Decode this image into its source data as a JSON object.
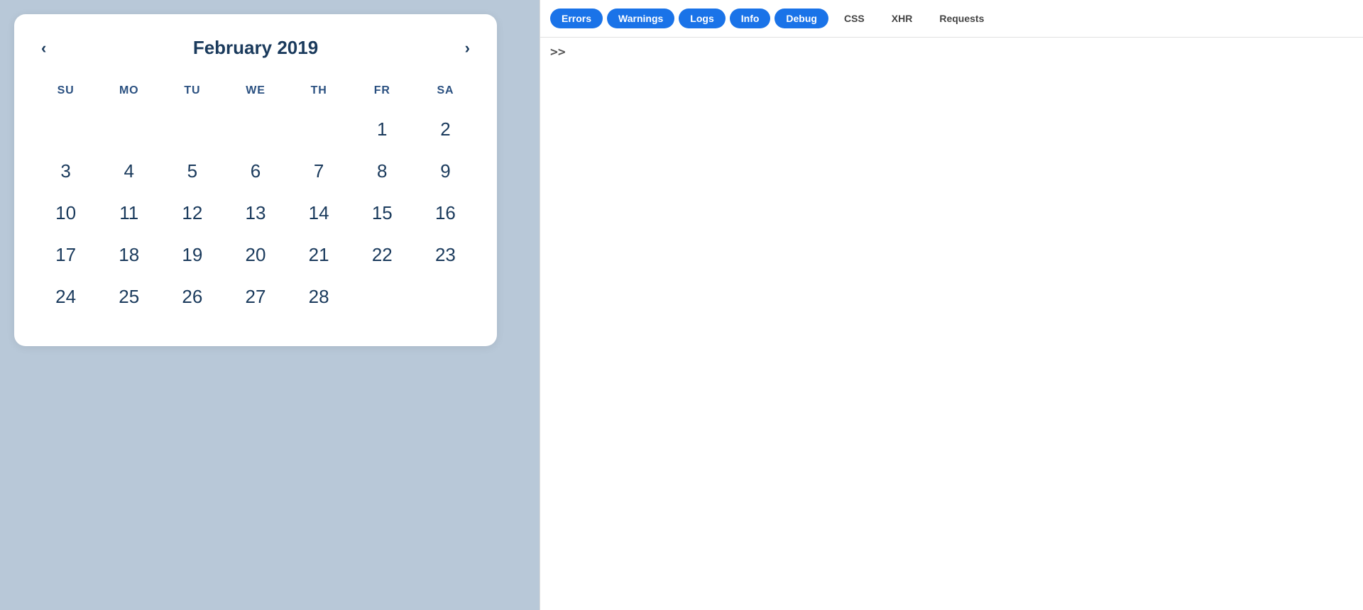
{
  "calendar": {
    "title": "February 2019",
    "weekdays": [
      "Su",
      "Mo",
      "Tu",
      "We",
      "Th",
      "Fr",
      "Sa"
    ],
    "weeks": [
      [
        "",
        "",
        "",
        "",
        "",
        "1",
        "2"
      ],
      [
        "3",
        "4",
        "5",
        "6",
        "7",
        "8",
        "9"
      ],
      [
        "10",
        "11",
        "12",
        "13",
        "14",
        "15",
        "16"
      ],
      [
        "17",
        "18",
        "19",
        "20",
        "21",
        "22",
        "23"
      ],
      [
        "24",
        "25",
        "26",
        "27",
        "28",
        "",
        ""
      ]
    ],
    "prev_label": "‹",
    "next_label": "›"
  },
  "devtools": {
    "filters": [
      {
        "label": "Errors",
        "active": true
      },
      {
        "label": "Warnings",
        "active": true
      },
      {
        "label": "Logs",
        "active": true
      },
      {
        "label": "Info",
        "active": true
      },
      {
        "label": "Debug",
        "active": true
      },
      {
        "label": "CSS",
        "active": false
      },
      {
        "label": "XHR",
        "active": false
      },
      {
        "label": "Requests",
        "active": false
      }
    ],
    "console_prompt": ">>"
  }
}
